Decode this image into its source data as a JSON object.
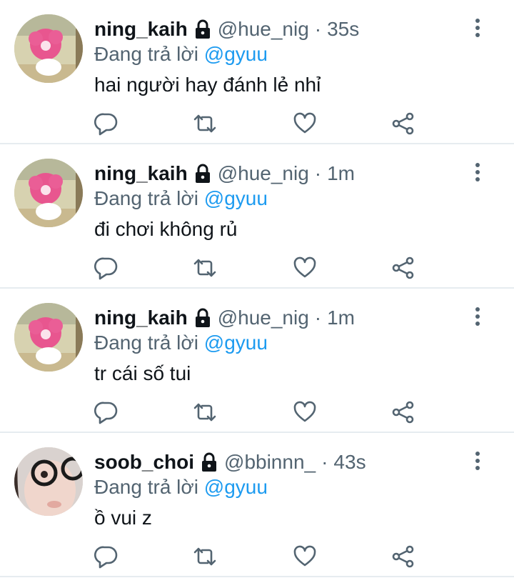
{
  "colors": {
    "accent": "#1d9bf0",
    "muted": "#536471",
    "divider": "#e6ecf0"
  },
  "icons": {
    "more": "more-vertical-icon",
    "lock": "lock-icon",
    "reply": "reply-icon",
    "retweet": "retweet-icon",
    "like": "heart-icon",
    "share": "share-icon"
  },
  "tweets": [
    {
      "name": "ning_kaih",
      "handle": "@hue_nig",
      "separator": "·",
      "time": "35s",
      "reply_prefix": "Đang trả lời",
      "reply_to": "@gyuu",
      "text": "hai người hay đánh lẻ nhỉ"
    },
    {
      "name": "ning_kaih",
      "handle": "@hue_nig",
      "separator": "·",
      "time": "1m",
      "reply_prefix": "Đang trả lời",
      "reply_to": "@gyuu",
      "text": "đi chơi không rủ"
    },
    {
      "name": "ning_kaih",
      "handle": "@hue_nig",
      "separator": "·",
      "time": "1m",
      "reply_prefix": "Đang trả lời",
      "reply_to": "@gyuu",
      "text": "tr cái số tui"
    },
    {
      "name": "soob_choi",
      "handle": "@bbinnn_",
      "separator": "·",
      "time": "43s",
      "reply_prefix": "Đang trả lời",
      "reply_to": "@gyuu",
      "text": "ồ vui z"
    }
  ]
}
